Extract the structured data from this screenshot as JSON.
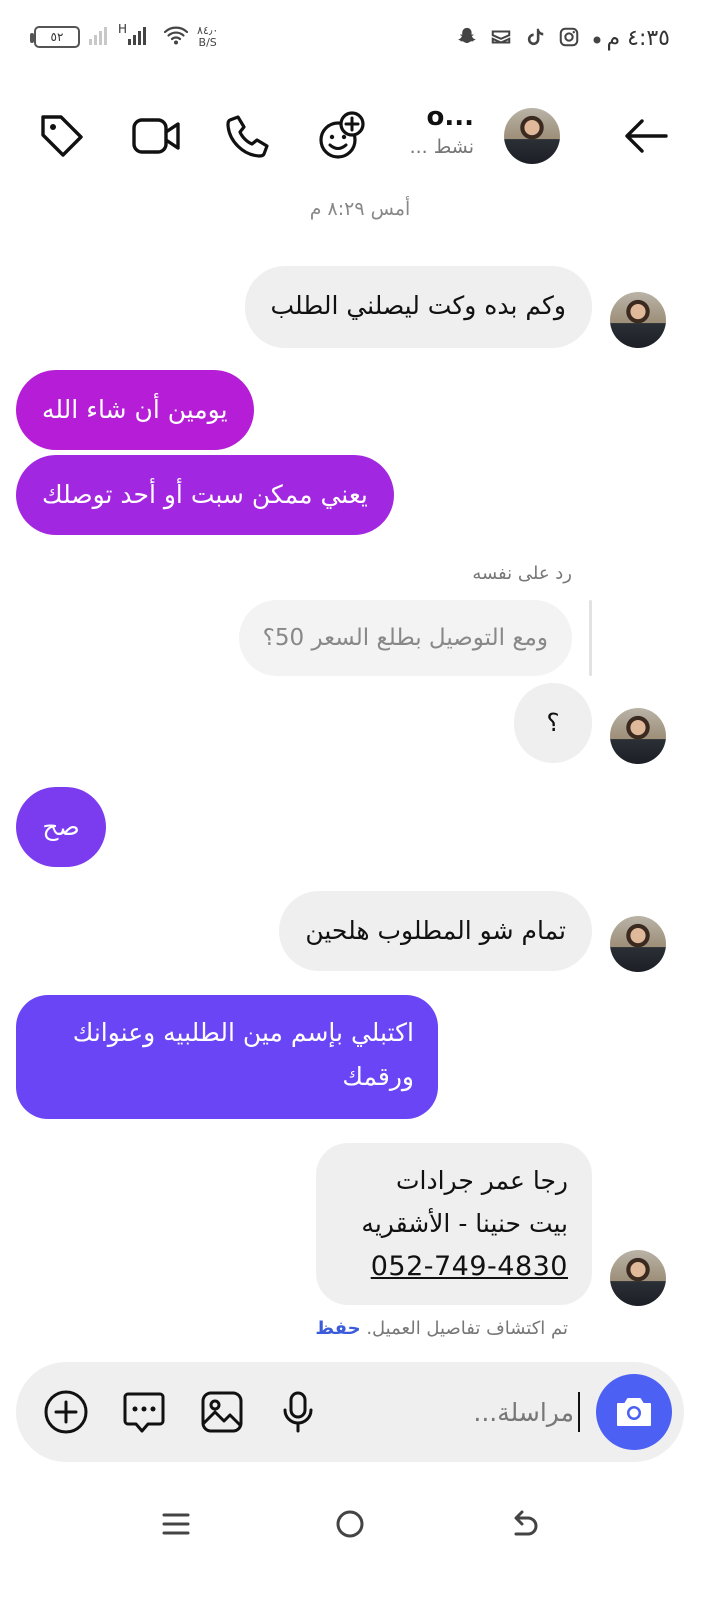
{
  "status_bar": {
    "time": "٤:٣٥ م",
    "battery": "٥٢",
    "network": "H",
    "speed_value": "٨٤٫٠",
    "speed_unit": "B/S",
    "icons": [
      "dot-icon",
      "instagram-icon",
      "tiktok-icon",
      "capcut-icon",
      "snapchat-icon"
    ]
  },
  "header": {
    "name": "o...",
    "status": "نشط ..."
  },
  "chat": {
    "timestamp": "أمس ٨:٢٩ م",
    "messages": [
      {
        "text": "وكم بده وكت ليصلني الطلب"
      },
      {
        "text": "يومين أن شاء الله"
      },
      {
        "text": "يعني ممكن سبت أو أحد توصلك"
      },
      {
        "text": "؟"
      },
      {
        "text": "صح"
      },
      {
        "text": "تمام شو المطلوب هلحين"
      },
      {
        "text": "اكتبلي بإسم مين الطلبيه وعنوانك ورقمك"
      }
    ],
    "reply": {
      "label": "رد على نفسه",
      "quote": "ومع التوصيل بطلع السعر 50؟"
    },
    "contact_message": {
      "line1": "رجا عمر جرادات",
      "line2": "بيت حنينا - الأشقريه",
      "phone": "052-749-4830"
    },
    "detected_note": "تم اكتشاف تفاصيل العميل.",
    "save_label": "حفظ"
  },
  "composer": {
    "placeholder": "مراسلة..."
  },
  "colors": {
    "out_bubble_1": "#b51ed6",
    "out_bubble_2": "#a127e0",
    "out_bubble_3": "#7b3cf0",
    "out_bubble_4": "#6a45f5",
    "camera_button": "#4c61f4",
    "save_link": "#3b5bdb"
  }
}
